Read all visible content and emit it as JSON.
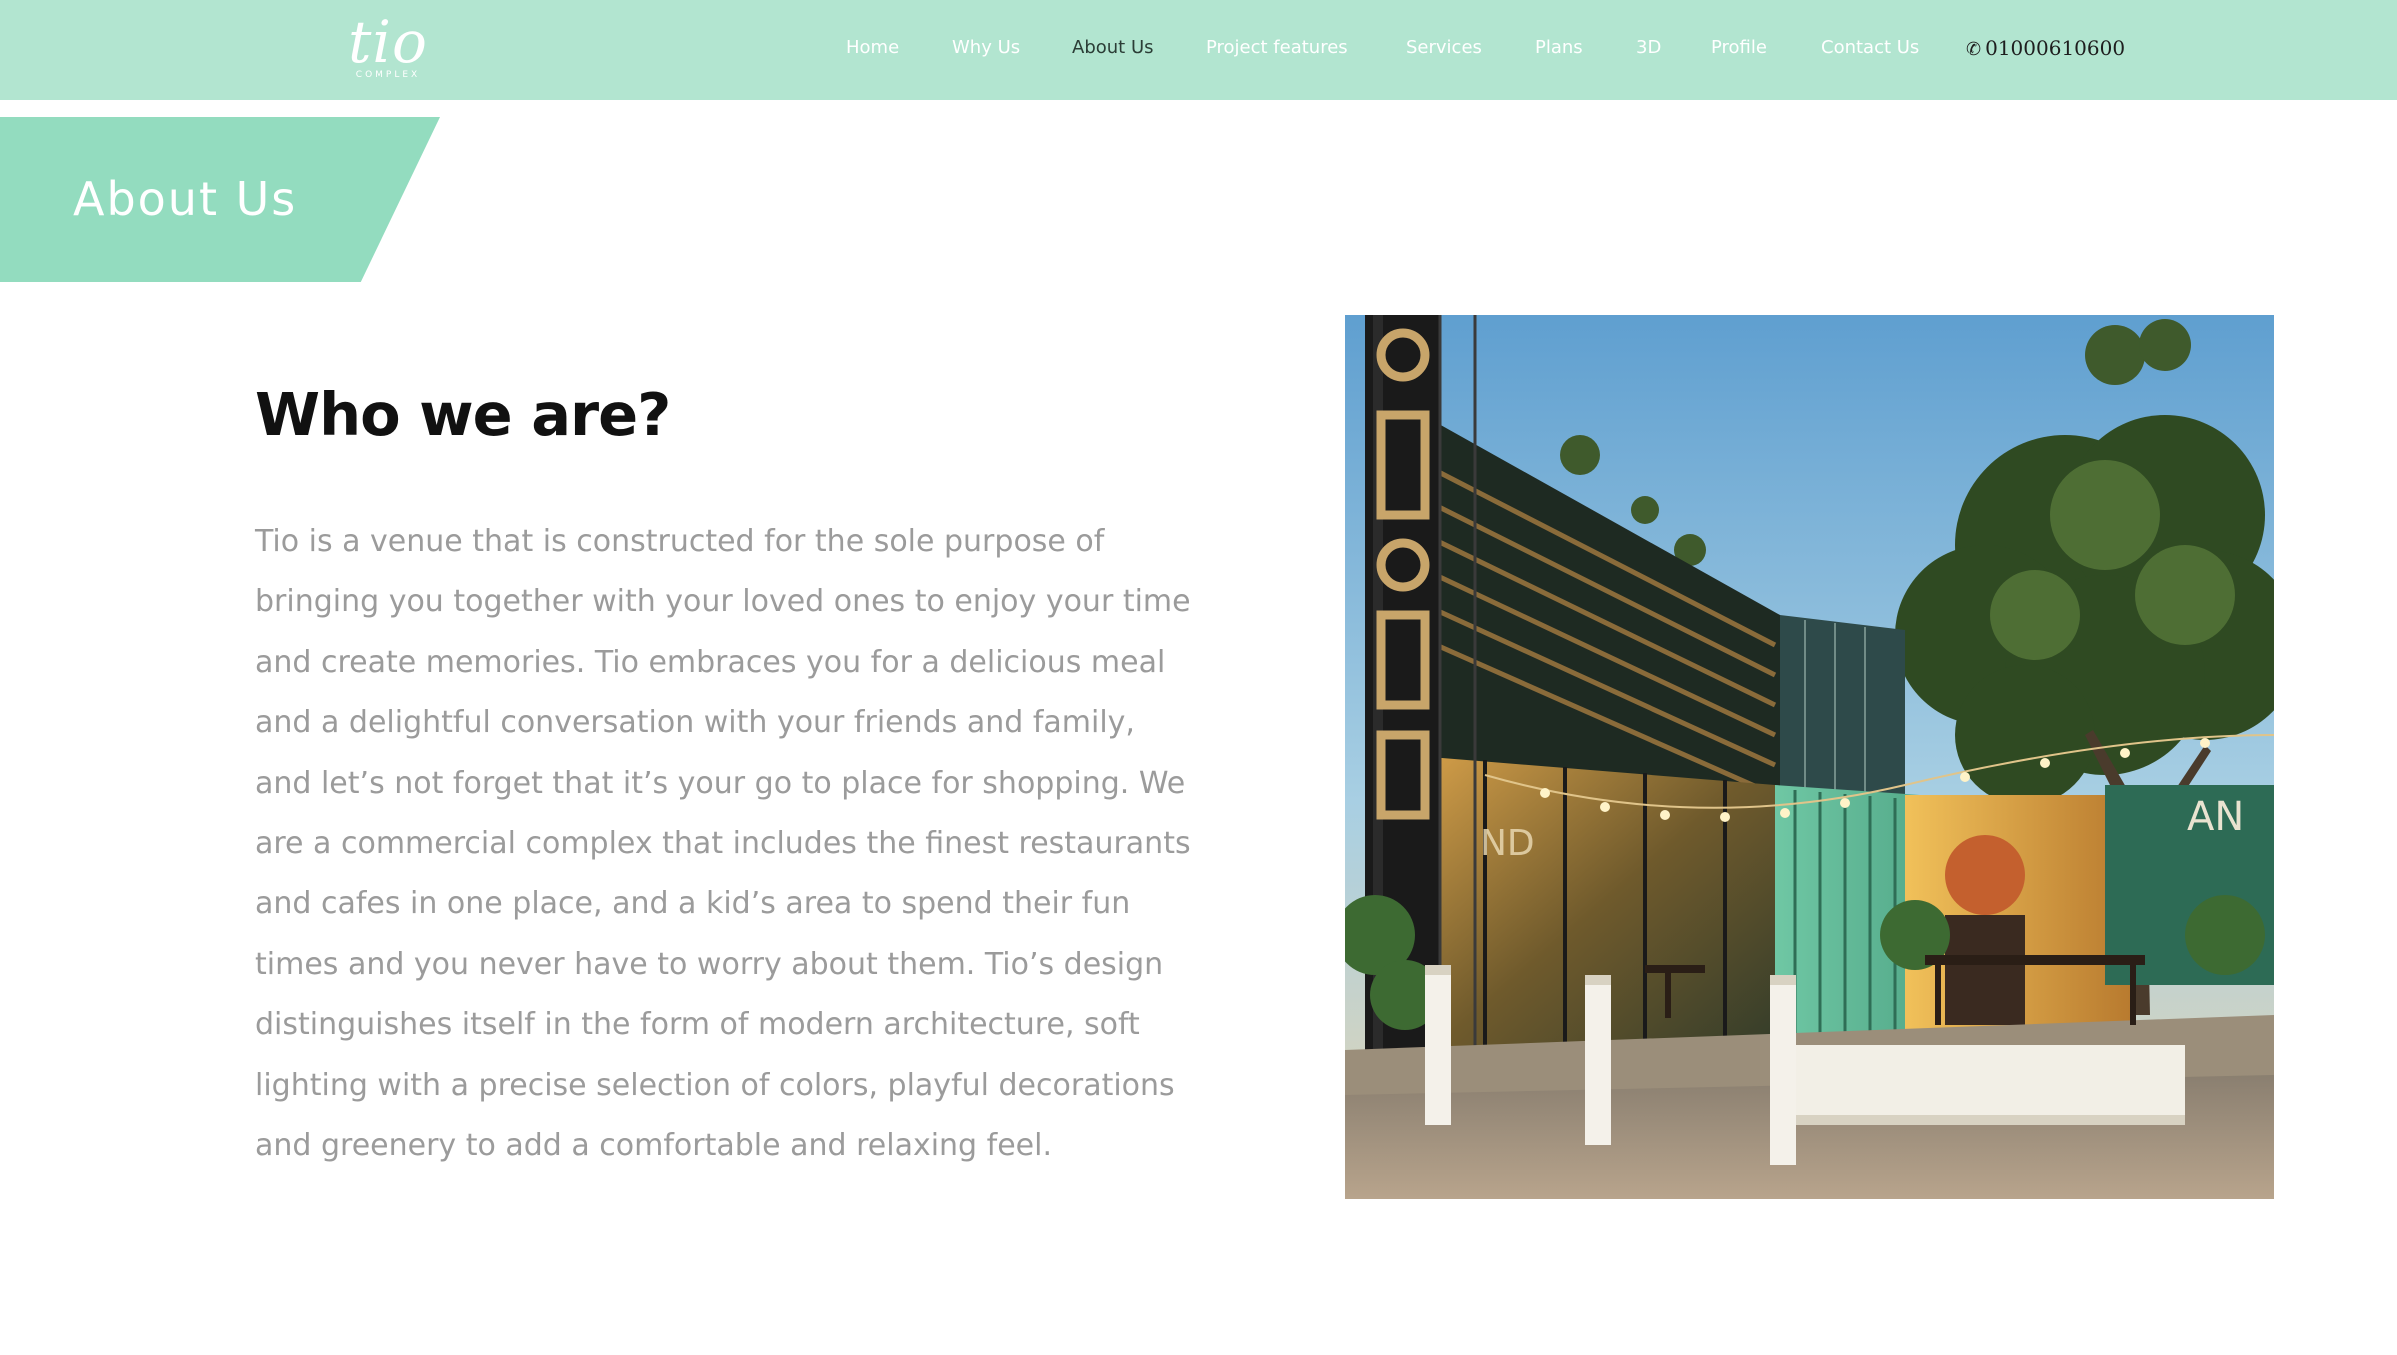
{
  "nav": {
    "logo_text": "tio",
    "logo_subtext": "COMPLEX",
    "links": [
      {
        "label": "Home"
      },
      {
        "label": "Why Us"
      },
      {
        "label": "About Us"
      },
      {
        "label": "Project features"
      },
      {
        "label": "Services"
      },
      {
        "label": "Plans"
      },
      {
        "label": "3D"
      },
      {
        "label": "Profile"
      },
      {
        "label": "Contact Us"
      }
    ],
    "active_link": "About Us",
    "phone_icon": "phone-icon",
    "phone": "01000610600"
  },
  "banner": {
    "title": "About Us"
  },
  "content": {
    "heading": "Who we are?",
    "paragraph": "Tio is a venue that is constructed for the sole purpose of bringing you together with your loved ones to enjoy your time and create memories. Tio embraces you for a delicious meal and a delightful conversation with your friends and family, and let’s not forget that it’s your go to place for shopping. We are a commercial complex that includes the finest restaurants and cafes in one place, and a kid’s area to spend their fun times and you never have to worry about them. Tio’s design distinguishes itself in the form of modern architecture, soft lighting with a precise selection of colors, playful decorations and greenery to add a comfortable and relaxing feel.",
    "photo_signs": [
      "ND",
      "AN"
    ]
  },
  "colors": {
    "nav_bg": "#b2e5d0",
    "banner_bg": "#93dcbf",
    "nav_text": "#ffffff",
    "nav_active": "#2b3d36",
    "heading": "#111111",
    "body_text": "#9b9b9b"
  }
}
